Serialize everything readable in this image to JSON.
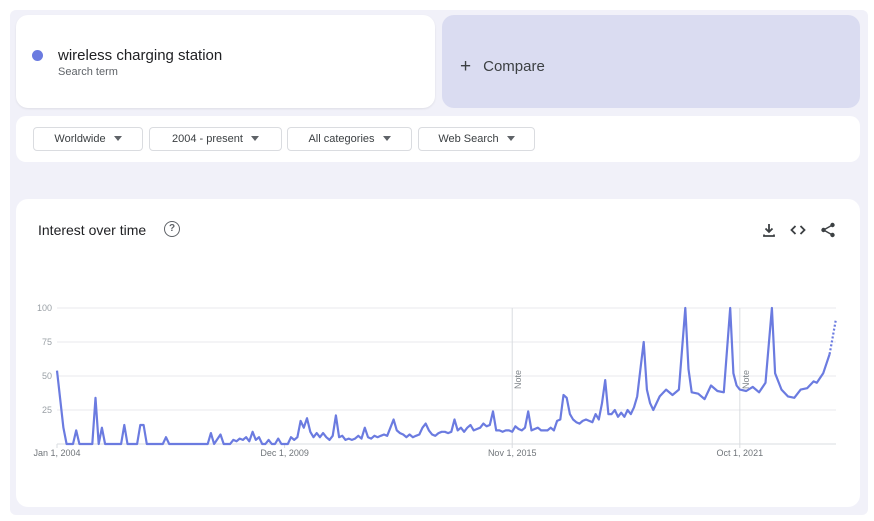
{
  "search_term": {
    "name": "wireless charging station",
    "subtitle": "Search term",
    "color": "#6b7be0"
  },
  "compare": {
    "plus": "+",
    "label": "Compare"
  },
  "filters": {
    "region": "Worldwide",
    "time_range": "2004 - present",
    "category": "All categories",
    "search_type": "Web Search"
  },
  "panel": {
    "title": "Interest over time",
    "help": "?",
    "icons": [
      "download-icon",
      "embed-code-icon",
      "share-icon"
    ]
  },
  "chart_data": {
    "type": "line",
    "title": "Interest over time",
    "x_range": [
      "Jan 1, 2004",
      "Apr 1, 2024"
    ],
    "x_ticks": [
      "Jan 1, 2004",
      "Dec 1, 2009",
      "Nov 1, 2015",
      "Oct 1, 2021"
    ],
    "y_ticks": [
      "100",
      "75",
      "50",
      "25"
    ],
    "ylim": [
      0,
      100
    ],
    "grid": true,
    "line_color": "#6b7be0",
    "notes": [
      {
        "date": "Nov 1, 2015",
        "label": "Note"
      },
      {
        "date": "Oct 1, 2021",
        "label": "Note"
      }
    ],
    "partial_data_from": "Feb 1, 2024",
    "series": [
      {
        "name": "wireless charging station",
        "points": [
          [
            "Jan 1, 2004",
            54
          ],
          [
            "Mar 1, 2004",
            12
          ],
          [
            "Apr 1, 2004",
            0
          ],
          [
            "Jun 1, 2004",
            0
          ],
          [
            "Jul 1, 2004",
            10
          ],
          [
            "Aug 1, 2004",
            0
          ],
          [
            "Dec 1, 2004",
            0
          ],
          [
            "Jan 1, 2005",
            34
          ],
          [
            "Feb 1, 2005",
            0
          ],
          [
            "Mar 1, 2005",
            12
          ],
          [
            "Apr 1, 2005",
            0
          ],
          [
            "Sep 1, 2005",
            0
          ],
          [
            "Oct 1, 2005",
            14
          ],
          [
            "Nov 1, 2005",
            0
          ],
          [
            "Feb 1, 2006",
            0
          ],
          [
            "Mar 1, 2006",
            14
          ],
          [
            "Apr 1, 2006",
            14
          ],
          [
            "May 1, 2006",
            0
          ],
          [
            "Oct 1, 2006",
            0
          ],
          [
            "Nov 1, 2006",
            5
          ],
          [
            "Dec 1, 2006",
            0
          ],
          [
            "Dec 1, 2007",
            0
          ],
          [
            "Jan 1, 2008",
            8
          ],
          [
            "Feb 1, 2008",
            0
          ],
          [
            "Apr 1, 2008",
            7
          ],
          [
            "May 1, 2008",
            0
          ],
          [
            "Jul 1, 2008",
            0
          ],
          [
            "Aug 1, 2008",
            3
          ],
          [
            "Sep 1, 2008",
            2
          ],
          [
            "Oct 1, 2008",
            4
          ],
          [
            "Nov 1, 2008",
            3
          ],
          [
            "Dec 1, 2008",
            5
          ],
          [
            "Jan 1, 2009",
            2
          ],
          [
            "Feb 1, 2009",
            9
          ],
          [
            "Mar 1, 2009",
            3
          ],
          [
            "Apr 1, 2009",
            5
          ],
          [
            "May 1, 2009",
            0
          ],
          [
            "Jun 1, 2009",
            0
          ],
          [
            "Jul 1, 2009",
            3
          ],
          [
            "Aug 1, 2009",
            0
          ],
          [
            "Sep 1, 2009",
            0
          ],
          [
            "Oct 1, 2009",
            4
          ],
          [
            "Nov 1, 2009",
            0
          ],
          [
            "Jan 1, 2010",
            0
          ],
          [
            "Feb 1, 2010",
            5
          ],
          [
            "Mar 1, 2010",
            3
          ],
          [
            "Apr 1, 2010",
            5
          ],
          [
            "May 1, 2010",
            17
          ],
          [
            "Jun 1, 2010",
            12
          ],
          [
            "Jul 1, 2010",
            19
          ],
          [
            "Aug 1, 2010",
            9
          ],
          [
            "Sep 1, 2010",
            5
          ],
          [
            "Oct 1, 2010",
            8
          ],
          [
            "Nov 1, 2010",
            5
          ],
          [
            "Dec 1, 2010",
            8
          ],
          [
            "Jan 1, 2011",
            5
          ],
          [
            "Feb 1, 2011",
            3
          ],
          [
            "Mar 1, 2011",
            6
          ],
          [
            "Apr 1, 2011",
            21
          ],
          [
            "May 1, 2011",
            5
          ],
          [
            "Jun 1, 2011",
            6
          ],
          [
            "Jul 1, 2011",
            3
          ],
          [
            "Aug 1, 2011",
            4
          ],
          [
            "Sep 1, 2011",
            3
          ],
          [
            "Oct 1, 2011",
            4
          ],
          [
            "Nov 1, 2011",
            6
          ],
          [
            "Dec 1, 2011",
            4
          ],
          [
            "Jan 1, 2012",
            12
          ],
          [
            "Feb 1, 2012",
            5
          ],
          [
            "Mar 1, 2012",
            4
          ],
          [
            "Apr 1, 2012",
            6
          ],
          [
            "May 1, 2012",
            5
          ],
          [
            "Jun 1, 2012",
            6
          ],
          [
            "Jul 1, 2012",
            7
          ],
          [
            "Aug 1, 2012",
            6
          ],
          [
            "Sep 1, 2012",
            12
          ],
          [
            "Oct 1, 2012",
            18
          ],
          [
            "Nov 1, 2012",
            10
          ],
          [
            "Dec 1, 2012",
            8
          ],
          [
            "Jan 1, 2013",
            7
          ],
          [
            "Feb 1, 2013",
            5
          ],
          [
            "Mar 1, 2013",
            7
          ],
          [
            "Apr 1, 2013",
            5
          ],
          [
            "May 1, 2013",
            6
          ],
          [
            "Jun 1, 2013",
            7
          ],
          [
            "Jul 1, 2013",
            12
          ],
          [
            "Aug 1, 2013",
            15
          ],
          [
            "Sep 1, 2013",
            10
          ],
          [
            "Oct 1, 2013",
            7
          ],
          [
            "Nov 1, 2013",
            6
          ],
          [
            "Dec 1, 2013",
            8
          ],
          [
            "Jan 1, 2014",
            9
          ],
          [
            "Feb 1, 2014",
            9
          ],
          [
            "Mar 1, 2014",
            8
          ],
          [
            "Apr 1, 2014",
            9
          ],
          [
            "May 1, 2014",
            18
          ],
          [
            "Jun 1, 2014",
            10
          ],
          [
            "Jul 1, 2014",
            12
          ],
          [
            "Aug 1, 2014",
            9
          ],
          [
            "Sep 1, 2014",
            12
          ],
          [
            "Oct 1, 2014",
            14
          ],
          [
            "Nov 1, 2014",
            10
          ],
          [
            "Dec 1, 2014",
            11
          ],
          [
            "Jan 1, 2015",
            12
          ],
          [
            "Feb 1, 2015",
            15
          ],
          [
            "Mar 1, 2015",
            13
          ],
          [
            "Apr 1, 2015",
            14
          ],
          [
            "May 1, 2015",
            24
          ],
          [
            "Jun 1, 2015",
            10
          ],
          [
            "Jul 1, 2015",
            10
          ],
          [
            "Aug 1, 2015",
            9
          ],
          [
            "Sep 1, 2015",
            10
          ],
          [
            "Oct 1, 2015",
            10
          ],
          [
            "Nov 1, 2015",
            9
          ],
          [
            "Dec 1, 2015",
            13
          ],
          [
            "Jan 1, 2016",
            11
          ],
          [
            "Feb 1, 2016",
            10
          ],
          [
            "Mar 1, 2016",
            12
          ],
          [
            "Apr 1, 2016",
            24
          ],
          [
            "May 1, 2016",
            10
          ],
          [
            "Jun 1, 2016",
            11
          ],
          [
            "Jul 1, 2016",
            12
          ],
          [
            "Aug 1, 2016",
            10
          ],
          [
            "Sep 1, 2016",
            10
          ],
          [
            "Oct 1, 2016",
            10
          ],
          [
            "Nov 1, 2016",
            12
          ],
          [
            "Dec 1, 2016",
            10
          ],
          [
            "Jan 1, 2017",
            17
          ],
          [
            "Feb 1, 2017",
            18
          ],
          [
            "Mar 1, 2017",
            36
          ],
          [
            "Apr 1, 2017",
            34
          ],
          [
            "May 1, 2017",
            22
          ],
          [
            "Jun 1, 2017",
            18
          ],
          [
            "Jul 1, 2017",
            16
          ],
          [
            "Aug 1, 2017",
            15
          ],
          [
            "Sep 1, 2017",
            17
          ],
          [
            "Oct 1, 2017",
            18
          ],
          [
            "Nov 1, 2017",
            17
          ],
          [
            "Dec 1, 2017",
            16
          ],
          [
            "Jan 1, 2018",
            22
          ],
          [
            "Feb 1, 2018",
            18
          ],
          [
            "Mar 1, 2018",
            30
          ],
          [
            "Apr 1, 2018",
            47
          ],
          [
            "May 1, 2018",
            22
          ],
          [
            "Jun 1, 2018",
            22
          ],
          [
            "Jul 1, 2018",
            25
          ],
          [
            "Aug 1, 2018",
            20
          ],
          [
            "Sep 1, 2018",
            23
          ],
          [
            "Oct 1, 2018",
            20
          ],
          [
            "Nov 1, 2018",
            25
          ],
          [
            "Dec 1, 2018",
            22
          ],
          [
            "Jan 1, 2019",
            27
          ],
          [
            "Feb 1, 2019",
            35
          ],
          [
            "Mar 1, 2019",
            55
          ],
          [
            "Apr 1, 2019",
            75
          ],
          [
            "May 1, 2019",
            40
          ],
          [
            "Jun 1, 2019",
            30
          ],
          [
            "Jul 1, 2019",
            25
          ],
          [
            "Sep 1, 2019",
            35
          ],
          [
            "Nov 1, 2019",
            40
          ],
          [
            "Jan 1, 2020",
            36
          ],
          [
            "Mar 1, 2020",
            40
          ],
          [
            "May 1, 2020",
            100
          ],
          [
            "Jun 1, 2020",
            55
          ],
          [
            "Jul 1, 2020",
            38
          ],
          [
            "Sep 1, 2020",
            37
          ],
          [
            "Nov 1, 2020",
            33
          ],
          [
            "Jan 1, 2021",
            43
          ],
          [
            "Mar 1, 2021",
            39
          ],
          [
            "May 1, 2021",
            38
          ],
          [
            "Jul 1, 2021",
            100
          ],
          [
            "Aug 1, 2021",
            52
          ],
          [
            "Sep 1, 2021",
            43
          ],
          [
            "Oct 1, 2021",
            40
          ],
          [
            "Dec 1, 2021",
            39
          ],
          [
            "Feb 1, 2022",
            42
          ],
          [
            "Apr 1, 2022",
            38
          ],
          [
            "Jun 1, 2022",
            45
          ],
          [
            "Aug 1, 2022",
            100
          ],
          [
            "Sep 1, 2022",
            52
          ],
          [
            "Nov 1, 2022",
            40
          ],
          [
            "Jan 1, 2023",
            35
          ],
          [
            "Mar 1, 2023",
            34
          ],
          [
            "May 1, 2023",
            40
          ],
          [
            "Jul 1, 2023",
            41
          ],
          [
            "Sep 1, 2023",
            46
          ],
          [
            "Oct 1, 2023",
            45
          ],
          [
            "Dec 1, 2023",
            52
          ],
          [
            "Feb 1, 2024",
            66
          ],
          [
            "Apr 1, 2024",
            92
          ]
        ]
      }
    ]
  }
}
